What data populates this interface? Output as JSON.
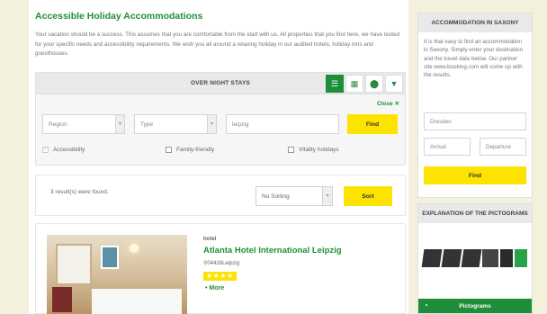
{
  "page": {
    "title": "Accessible Holiday Accommodations",
    "intro": "Your vacation should be a success. This assumes that you are comfortable from the start with us. All properties that you find here, we have tested for your specific needs and accessibility requirements. We wish you all around a relaxing holiday in our audited hotels, holiday inns and guesthouses."
  },
  "search": {
    "bar_title": "OVER NIGHT STAYS",
    "close_label": "Close",
    "region_placeholder": "Region",
    "type_placeholder": "Type",
    "city_value": "leipzig",
    "find_label": "Find",
    "checkboxes": [
      {
        "label": "Accessibility",
        "checked": true
      },
      {
        "label": "Family-friendly",
        "checked": false
      },
      {
        "label": "Vitality holidays",
        "checked": false
      }
    ]
  },
  "results": {
    "count_text": "3 result(s) were found.",
    "sort_selected": "No Sorting",
    "sort_label": "Sort"
  },
  "hotel": {
    "type": "hotel",
    "name": "Atlanta Hotel International Leipzig",
    "location": "04416Leipzig",
    "stars_glyph": "★★★★",
    "more_label": "• More"
  },
  "sidebar": {
    "accommodation": {
      "title": "ACCOMMODATION IN SAXONY",
      "text": "It is that easy to find an accommodation in Saxony. Simply enter your destination and the travel date below. Our partner site www.booking.com will come up with the results.",
      "destination_value": "Dresden",
      "arrival_placeholder": "Arrival",
      "departure_placeholder": "Departure",
      "find_label": "Find"
    },
    "pictograms": {
      "title": "EXPLANATION OF THE PICTOGRAMS",
      "button_label": "Pictograms"
    }
  },
  "colors": {
    "accent_green": "#1f8e3a",
    "button_yellow": "#fce300",
    "page_background": "#f3f0dc"
  }
}
